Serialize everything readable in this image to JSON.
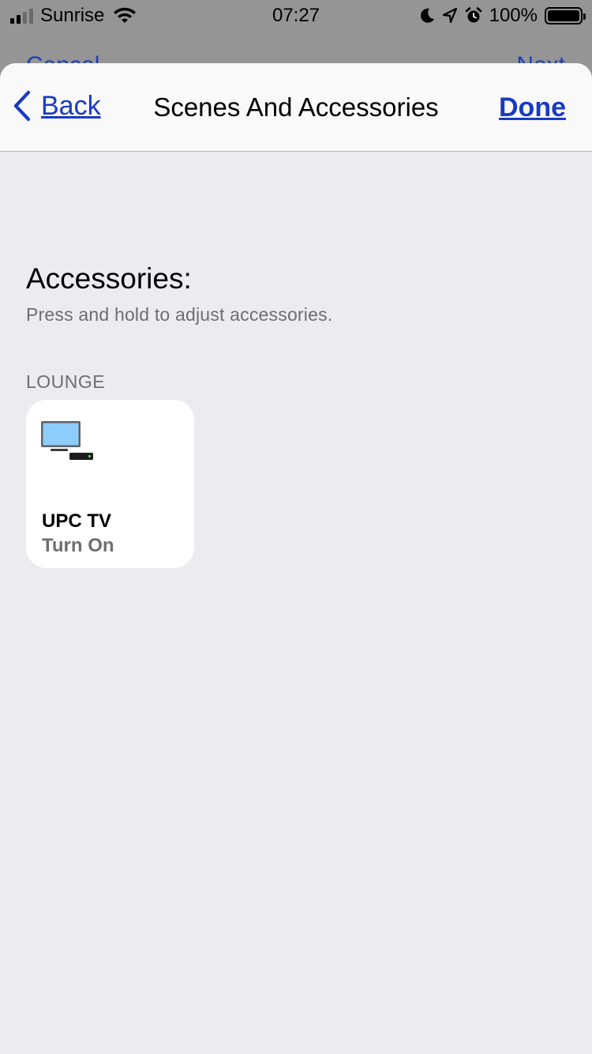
{
  "status_bar": {
    "carrier": "Sunrise",
    "time": "07:27",
    "battery_percent": "100%",
    "icons": [
      "signal-icon",
      "wifi-icon",
      "moon-icon",
      "location-icon",
      "alarm-icon",
      "battery-icon"
    ]
  },
  "underlying": {
    "left_label": "Cancel",
    "right_label": "Next"
  },
  "nav": {
    "back_label": "Back",
    "title": "Scenes And Accessories",
    "done_label": "Done"
  },
  "section": {
    "title": "Accessories:",
    "subtitle": "Press and hold to adjust accessories."
  },
  "room": {
    "label": "LOUNGE",
    "accessories": [
      {
        "name": "UPC TV",
        "state": "Turn On",
        "icon": "tv-icon"
      }
    ]
  },
  "colors": {
    "accent": "#1a3ac2",
    "background": "#ebebf0",
    "tile": "#ffffff",
    "secondary_text": "#6d6d72"
  }
}
